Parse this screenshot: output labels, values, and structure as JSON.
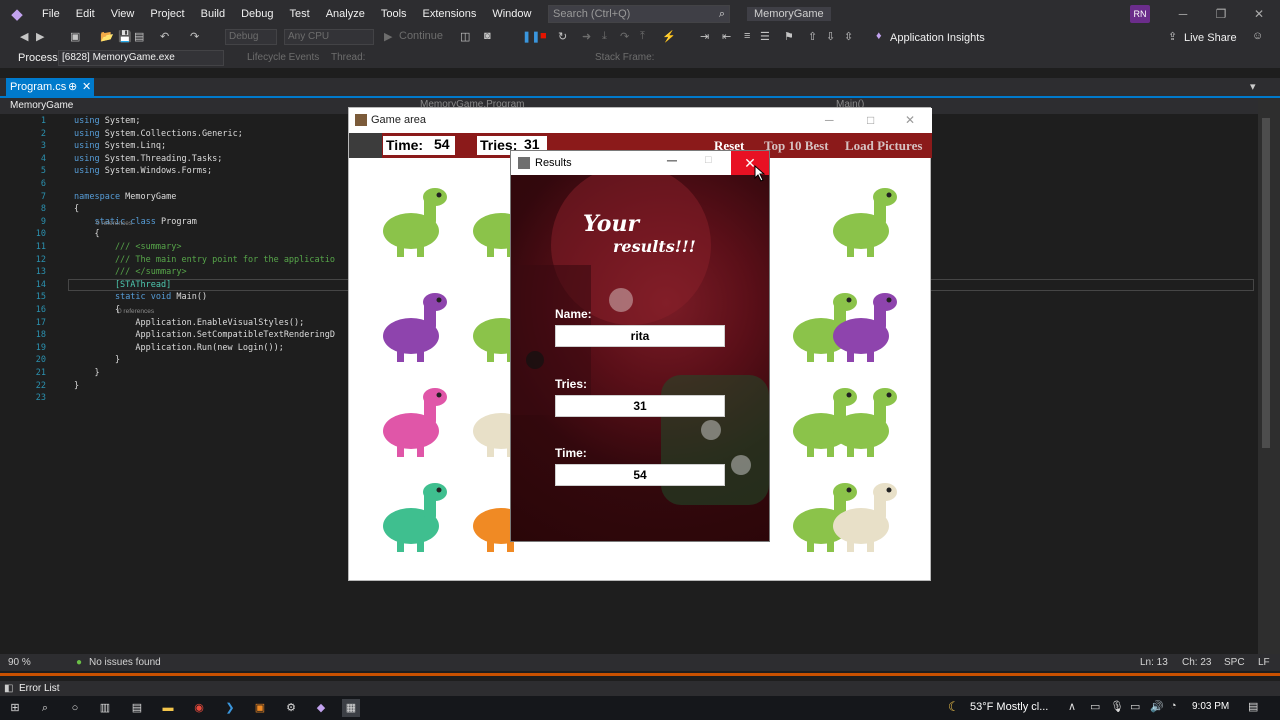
{
  "menu": [
    "File",
    "Edit",
    "View",
    "Project",
    "Build",
    "Debug",
    "Test",
    "Analyze",
    "Tools",
    "Extensions",
    "Window",
    "Help"
  ],
  "search": {
    "placeholder": "Search (Ctrl+Q)"
  },
  "solution_name": "MemoryGame",
  "avatar_initials": "RN",
  "toolbar": {
    "config": "Debug",
    "platform": "Any CPU",
    "continue_label": "Continue",
    "app_insights": "Application Insights",
    "live_share": "Live Share"
  },
  "debugbar": {
    "process_label": "Process:",
    "process_value": "[6828] MemoryGame.exe",
    "lifecycle": "Lifecycle Events",
    "thread": "Thread:",
    "stack_frame": "Stack Frame:"
  },
  "tab": {
    "label": "Program.cs"
  },
  "nav": {
    "project": "MemoryGame",
    "class": "MemoryGame.Program",
    "method": "Main()"
  },
  "code_lines": [
    {
      "n": "1",
      "text": "using System;"
    },
    {
      "n": "2",
      "text": "using System.Collections.Generic;"
    },
    {
      "n": "3",
      "text": "using System.Linq;"
    },
    {
      "n": "4",
      "text": "using System.Threading.Tasks;"
    },
    {
      "n": "5",
      "text": "using System.Windows.Forms;"
    },
    {
      "n": "6",
      "text": ""
    },
    {
      "n": "7",
      "text": "namespace MemoryGame"
    },
    {
      "n": "8",
      "text": "{"
    },
    {
      "n": "9",
      "text": "    static class Program"
    },
    {
      "n": "10",
      "text": "    {"
    },
    {
      "n": "11",
      "text": "        /// <summary>"
    },
    {
      "n": "12",
      "text": "        /// The main entry point for the applicatio"
    },
    {
      "n": "13",
      "text": "        /// </summary>"
    },
    {
      "n": "14",
      "text": "        [STAThread]"
    },
    {
      "n": "15",
      "text": "        static void Main()"
    },
    {
      "n": "16",
      "text": "        {"
    },
    {
      "n": "17",
      "text": "            Application.EnableVisualStyles();"
    },
    {
      "n": "18",
      "text": "            Application.SetCompatibleTextRenderingD"
    },
    {
      "n": "19",
      "text": "            Application.Run(new Login());"
    },
    {
      "n": "20",
      "text": "        }"
    },
    {
      "n": "21",
      "text": "    }"
    },
    {
      "n": "22",
      "text": "}"
    },
    {
      "n": "23",
      "text": ""
    }
  ],
  "references": "0 references",
  "editor_status": {
    "zoom": "90 %",
    "issues": "No issues found",
    "ln": "Ln: 13",
    "ch": "Ch: 23",
    "spc": "SPC",
    "lf": "LF"
  },
  "error_list": "Error List",
  "game": {
    "title": "Game area",
    "time_label": "Time:",
    "time_value": "54",
    "tries_label": "Tries:",
    "tries_value": "31",
    "reset": "Reset",
    "top10": "Top 10 Best",
    "load_pictures": "Load Pictures"
  },
  "results": {
    "title": "Results",
    "heading_line1": "Your",
    "heading_line2": "results!!!",
    "name_label": "Name:",
    "name_value": "rita",
    "tries_label": "Tries:",
    "tries_value": "31",
    "time_label": "Time:",
    "time_value": "54"
  },
  "taskbar": {
    "weather": "53°F  Mostly cl...",
    "clock": "9:03 PM"
  },
  "colors": {
    "accent": "#007acc",
    "close_red": "#e81123",
    "game_header": "#8b1a1a"
  }
}
